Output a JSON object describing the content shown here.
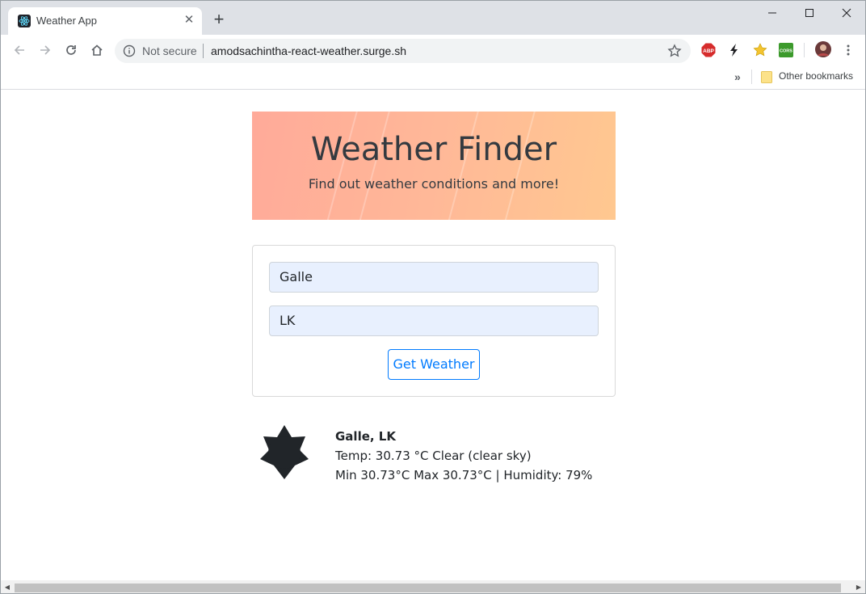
{
  "browser": {
    "tab_title": "Weather App",
    "address": {
      "security_label": "Not secure",
      "url": "amodsachintha-react-weather.surge.sh"
    },
    "bookmarks": {
      "overflow_label": "»",
      "other_bookmarks_label": "Other bookmarks"
    },
    "extensions": [
      "adblock-plus-icon",
      "lightning-icon",
      "star-extension-icon",
      "cors-icon",
      "profile-avatar"
    ],
    "ext_labels": {
      "abp": "ABP",
      "cors": "CORS"
    }
  },
  "app": {
    "title": "Weather Finder",
    "subtitle": "Find out weather conditions and more!",
    "form": {
      "city_value": "Galle",
      "country_value": "LK",
      "submit_label": "Get Weather"
    },
    "result": {
      "location": "Galle, LK",
      "line_temp": "Temp: 30.73 °C Clear (clear sky)",
      "line_range": "Min 30.73°C Max 30.73°C | Humidity: 79%",
      "icon": "sun-icon"
    }
  },
  "colors": {
    "accent": "#007bff",
    "hero_gradient_start": "#ffaa99",
    "hero_gradient_end": "#ffc890",
    "text_dark": "#343a40"
  }
}
